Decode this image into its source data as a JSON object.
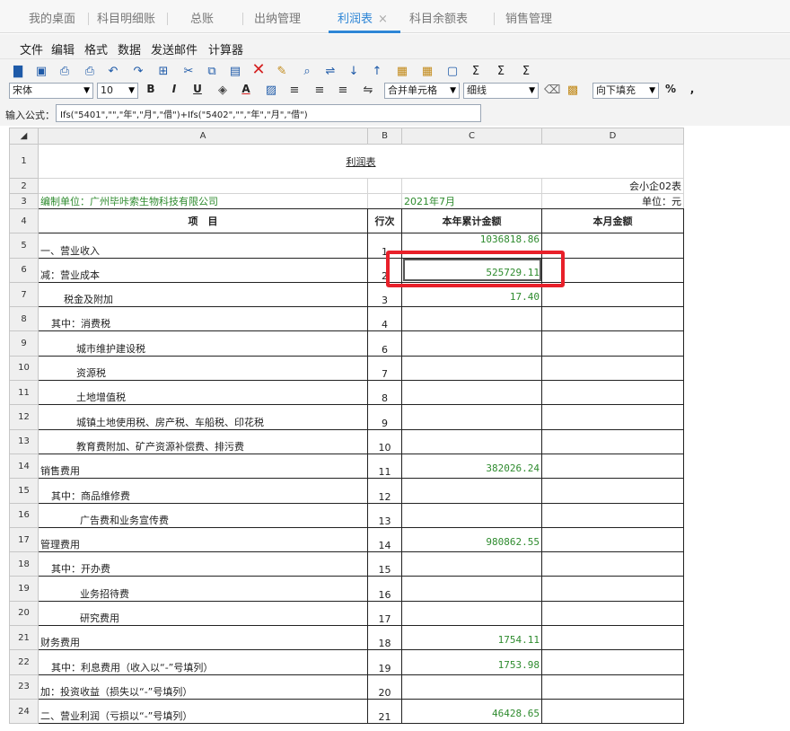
{
  "tabs": [
    {
      "label": "我的桌面",
      "active": false
    },
    {
      "label": "科目明细账",
      "active": false
    },
    {
      "label": "总账",
      "active": false
    },
    {
      "label": "出纳管理",
      "active": false
    },
    {
      "label": "利润表",
      "active": true,
      "close": "×"
    },
    {
      "label": "科目余额表",
      "active": false
    },
    {
      "label": "销售管理",
      "active": false
    }
  ],
  "menu": [
    "文件",
    "编辑",
    "格式",
    "数据",
    "发送邮件",
    "计算器"
  ],
  "toolbar": {
    "font": "宋体",
    "font_size": "10",
    "bold": "B",
    "italic": "I",
    "underline": "U",
    "font_color": "A",
    "merge": "合并单元格",
    "border": "细线",
    "fill": "向下填充",
    "percent": "%",
    "comma": ","
  },
  "formula": {
    "label": "输入公式：",
    "value": "Ifs(\"5401\",\"\",\"年\",\"月\",\"借\")+Ifs(\"5402\",\"\",\"年\",\"月\",\"借\")"
  },
  "columns": [
    "A",
    "B",
    "C",
    "D"
  ],
  "report": {
    "title": "利润表",
    "form_no": "会小企02表",
    "company": "编制单位：广州毕咔索生物科技有限公司",
    "period": "2021年7月",
    "unit": "单位：元",
    "col_item": "项　目",
    "col_line": "行次",
    "col_ytd": "本年累计金额",
    "col_month": "本月金额"
  },
  "rows": [
    {
      "n": "5",
      "item": "一、营业收入",
      "line": "1",
      "ytd": "1036818.86",
      "month": ""
    },
    {
      "n": "6",
      "item": "减：营业成本",
      "line": "2",
      "ytd": "525729.11",
      "month": ""
    },
    {
      "n": "7",
      "item": "税金及附加",
      "line": "3",
      "ytd": "17.40",
      "month": ""
    },
    {
      "n": "8",
      "item": "其中：消费税",
      "line": "4",
      "ytd": "",
      "month": ""
    },
    {
      "n": "9",
      "item": "城市维护建设税",
      "line": "6",
      "ytd": "",
      "month": ""
    },
    {
      "n": "10",
      "item": "资源税",
      "line": "7",
      "ytd": "",
      "month": ""
    },
    {
      "n": "11",
      "item": "土地增值税",
      "line": "8",
      "ytd": "",
      "month": ""
    },
    {
      "n": "12",
      "item": "城镇土地使用税、房产税、车船税、印花税",
      "line": "9",
      "ytd": "",
      "month": ""
    },
    {
      "n": "13",
      "item": "教育费附加、矿产资源补偿费、排污费",
      "line": "10",
      "ytd": "",
      "month": ""
    },
    {
      "n": "14",
      "item": "销售费用",
      "line": "11",
      "ytd": "382026.24",
      "month": ""
    },
    {
      "n": "15",
      "item": "其中：商品维修费",
      "line": "12",
      "ytd": "",
      "month": ""
    },
    {
      "n": "16",
      "item": "广告费和业务宣传费",
      "line": "13",
      "ytd": "",
      "month": ""
    },
    {
      "n": "17",
      "item": "管理费用",
      "line": "14",
      "ytd": "980862.55",
      "month": ""
    },
    {
      "n": "18",
      "item": "其中：开办费",
      "line": "15",
      "ytd": "",
      "month": ""
    },
    {
      "n": "19",
      "item": "业务招待费",
      "line": "16",
      "ytd": "",
      "month": ""
    },
    {
      "n": "20",
      "item": "研究费用",
      "line": "17",
      "ytd": "",
      "month": ""
    },
    {
      "n": "21",
      "item": "财务费用",
      "line": "18",
      "ytd": "1754.11",
      "month": ""
    },
    {
      "n": "22",
      "item": "其中：利息费用（收入以“-”号填列）",
      "line": "19",
      "ytd": "1753.98",
      "month": ""
    },
    {
      "n": "23",
      "item": "加：投资收益（损失以“-”号填列）",
      "line": "20",
      "ytd": "",
      "month": ""
    },
    {
      "n": "24",
      "item": "二、营业利润（亏损以“-”号填列）",
      "line": "21",
      "ytd": "46428.65",
      "month": ""
    }
  ],
  "highlight": {
    "color": "#e8202a"
  }
}
